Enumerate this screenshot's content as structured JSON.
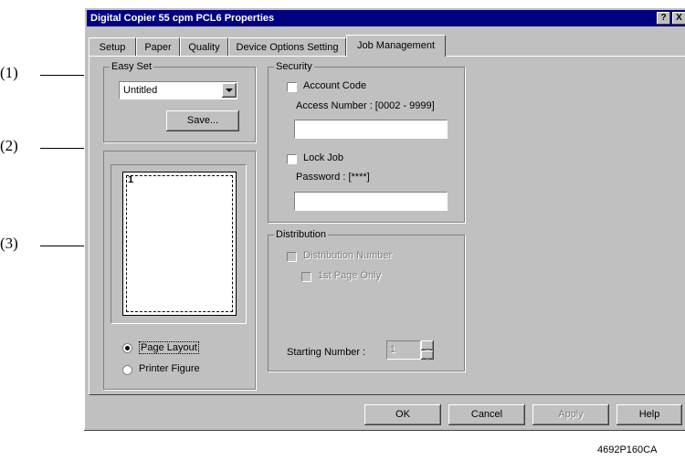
{
  "callouts": [
    "(1)",
    "(2)",
    "(3)"
  ],
  "window": {
    "title": "Digital Copier 55 cpm PCL6 Properties",
    "help_btn": "?",
    "close_btn": "X"
  },
  "tabs": [
    "Setup",
    "Paper",
    "Quality",
    "Device Options Setting",
    "Job Management"
  ],
  "easy_set": {
    "label": "Easy Set",
    "selected": "Untitled",
    "save_label": "Save..."
  },
  "preview": {
    "page_number": "1",
    "page_layout_label": "Page Layout",
    "printer_figure_label": "Printer Figure"
  },
  "security": {
    "label": "Security",
    "account_code_label": "Account Code",
    "access_number_label": "Access Number : [0002 - 9999]",
    "access_number_value": "",
    "lock_job_label": "Lock Job",
    "password_label": "Password : [****]",
    "password_value": ""
  },
  "distribution": {
    "label": "Distribution",
    "distribution_number_label": "Distribution Number",
    "first_page_only_label": "1st Page Only",
    "starting_number_label": "Starting Number :",
    "starting_number_value": "1"
  },
  "footer": {
    "ok": "OK",
    "cancel": "Cancel",
    "apply": "Apply",
    "help": "Help"
  },
  "figure_code": "4692P160CA"
}
